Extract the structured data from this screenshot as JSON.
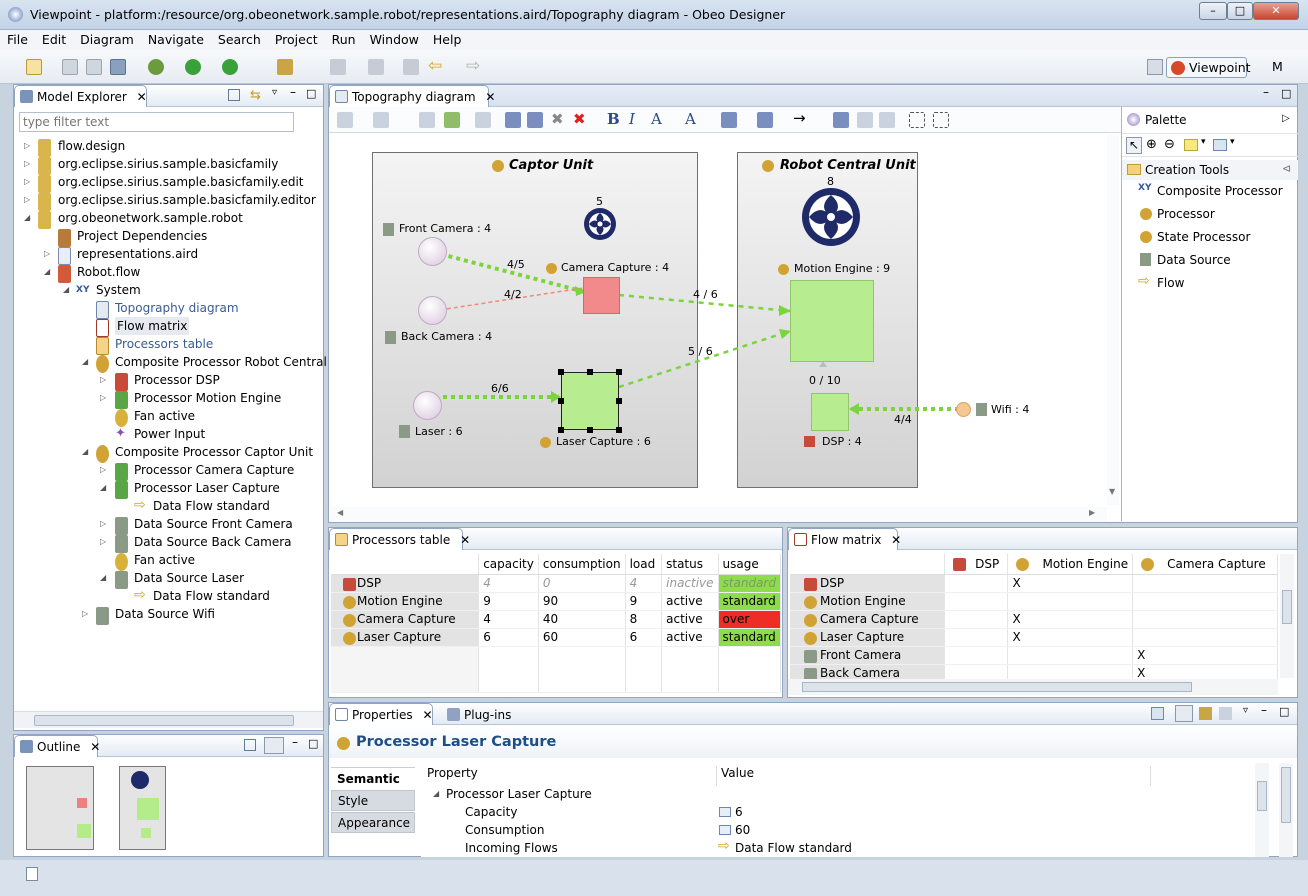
{
  "window": {
    "title": "Viewpoint - platform:/resource/org.obeonetwork.sample.robot/representations.aird/Topography diagram - Obeo Designer"
  },
  "menu": [
    "File",
    "Edit",
    "Diagram",
    "Navigate",
    "Search",
    "Project",
    "Run",
    "Window",
    "Help"
  ],
  "perspective": {
    "label": "Viewpoint",
    "other": "M"
  },
  "explorer": {
    "tab": "Model Explorer",
    "filter_placeholder": "type filter text",
    "items": [
      "flow.design",
      "org.eclipse.sirius.sample.basicfamily",
      "org.eclipse.sirius.sample.basicfamily.edit",
      "org.eclipse.sirius.sample.basicfamily.editor",
      "org.obeonetwork.sample.robot",
      "Project Dependencies",
      "representations.aird",
      "Robot.flow",
      "System",
      "Topography diagram",
      "Flow matrix",
      "Processors table",
      "Composite Processor Robot Central Un",
      "Processor DSP",
      "Processor Motion Engine",
      "Fan active",
      "Power Input",
      "Composite Processor Captor Unit",
      "Processor Camera Capture",
      "Processor Laser Capture",
      "Data Flow standard",
      "Data Source Front Camera",
      "Data Source Back Camera",
      "Fan active",
      "Data Source Laser",
      "Data Flow standard",
      "Data Source Wifi"
    ]
  },
  "outline": {
    "tab": "Outline"
  },
  "editor": {
    "tab": "Topography diagram",
    "containers": {
      "captor": "Captor Unit",
      "robot": "Robot Central Unit"
    },
    "labels": {
      "front_camera": "Front Camera : 4",
      "back_camera": "Back Camera : 4",
      "laser": "Laser : 6",
      "camera_capture": "Camera Capture : 4",
      "laser_capture": "Laser Capture : 6",
      "motion_engine": "Motion Engine : 9",
      "dsp": "DSP : 4",
      "wifi": "Wifi : 4",
      "fan_captor": "5",
      "fan_robot": "8",
      "edge_front": "4/5",
      "edge_back": "4/2",
      "edge_laser": "6/6",
      "edge_cc_me": "4 / 6",
      "edge_lc_me": "5 / 6",
      "edge_dsp_me": "0 / 10",
      "edge_wifi": "4/4"
    }
  },
  "palette": {
    "title": "Palette",
    "group": "Creation Tools",
    "tools": [
      "Composite Processor",
      "Processor",
      "State Processor",
      "Data Source",
      "Flow"
    ]
  },
  "processors_table": {
    "tab": "Processors table",
    "headers": [
      "capacity",
      "consumption",
      "load",
      "status",
      "usage"
    ],
    "rows": [
      {
        "name": "DSP",
        "capacity": "4",
        "consumption": "0",
        "load": "4",
        "status": "inactive",
        "usage": "standard"
      },
      {
        "name": "Motion Engine",
        "capacity": "9",
        "consumption": "90",
        "load": "9",
        "status": "active",
        "usage": "standard"
      },
      {
        "name": "Camera Capture",
        "capacity": "4",
        "consumption": "40",
        "load": "8",
        "status": "active",
        "usage": "over"
      },
      {
        "name": "Laser Capture",
        "capacity": "6",
        "consumption": "60",
        "load": "6",
        "status": "active",
        "usage": "standard"
      }
    ]
  },
  "flow_matrix": {
    "tab": "Flow matrix",
    "columns": [
      "DSP",
      "Motion Engine",
      "Camera Capture"
    ],
    "rows": [
      {
        "name": "DSP",
        "cells": [
          "",
          "X",
          ""
        ]
      },
      {
        "name": "Motion Engine",
        "cells": [
          "",
          "",
          ""
        ]
      },
      {
        "name": "Camera Capture",
        "cells": [
          "",
          "X",
          ""
        ]
      },
      {
        "name": "Laser Capture",
        "cells": [
          "",
          "X",
          ""
        ]
      },
      {
        "name": "Front Camera",
        "cells": [
          "",
          "",
          "X"
        ]
      },
      {
        "name": "Back Camera",
        "cells": [
          "",
          "",
          "X"
        ]
      }
    ]
  },
  "properties": {
    "tab": "Properties",
    "tab2": "Plug-ins",
    "title": "Processor Laser Capture",
    "side_tabs": [
      "Semantic",
      "Style",
      "Appearance"
    ],
    "col_property": "Property",
    "col_value": "Value",
    "group": "Processor Laser Capture",
    "rows": [
      {
        "name": "Capacity",
        "value": "6"
      },
      {
        "name": "Consumption",
        "value": "60"
      },
      {
        "name": "Incoming Flows",
        "value": "Data Flow standard"
      }
    ]
  }
}
